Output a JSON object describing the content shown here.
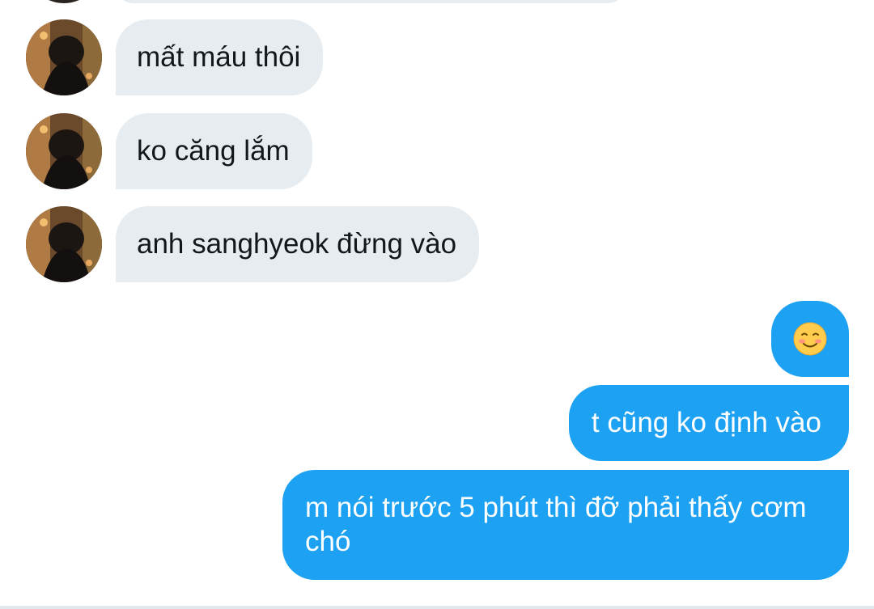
{
  "messages": [
    {
      "id": "m1",
      "side": "incoming",
      "text": "mất máu thôi"
    },
    {
      "id": "m2",
      "side": "incoming",
      "text": "ko căng lắm"
    },
    {
      "id": "m3",
      "side": "incoming",
      "text": "anh sanghyeok đừng vào"
    },
    {
      "id": "m4",
      "side": "outgoing",
      "emoji": "smiling-face-icon"
    },
    {
      "id": "m5",
      "side": "outgoing",
      "text": "t cũng ko định vào"
    },
    {
      "id": "m6",
      "side": "outgoing",
      "text": "m nói trước 5 phút thì đỡ phải thấy cơm chó"
    }
  ],
  "colors": {
    "incoming_bubble": "#e6ecf0",
    "outgoing_bubble": "#1da1f2",
    "incoming_text": "#14171a",
    "outgoing_text": "#ffffff"
  }
}
